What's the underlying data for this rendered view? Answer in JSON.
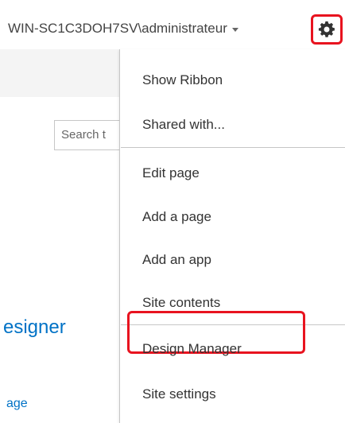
{
  "header": {
    "user_name": "WIN-SC1C3DOH7SV\\administrateur",
    "settings_icon": "gear-icon",
    "highlight_color": "#e8131f"
  },
  "background_page": {
    "search_placeholder": "Search t",
    "heading_partial": "esigner",
    "link_partial": "age"
  },
  "settings_menu": {
    "items": [
      {
        "label": "Show Ribbon"
      },
      {
        "label": "Shared with..."
      },
      {
        "label": "Edit page"
      },
      {
        "label": "Add a page"
      },
      {
        "label": "Add an app"
      },
      {
        "label": "Site contents"
      },
      {
        "label": "Design Manager",
        "highlighted": true
      },
      {
        "label": "Site settings"
      }
    ]
  }
}
